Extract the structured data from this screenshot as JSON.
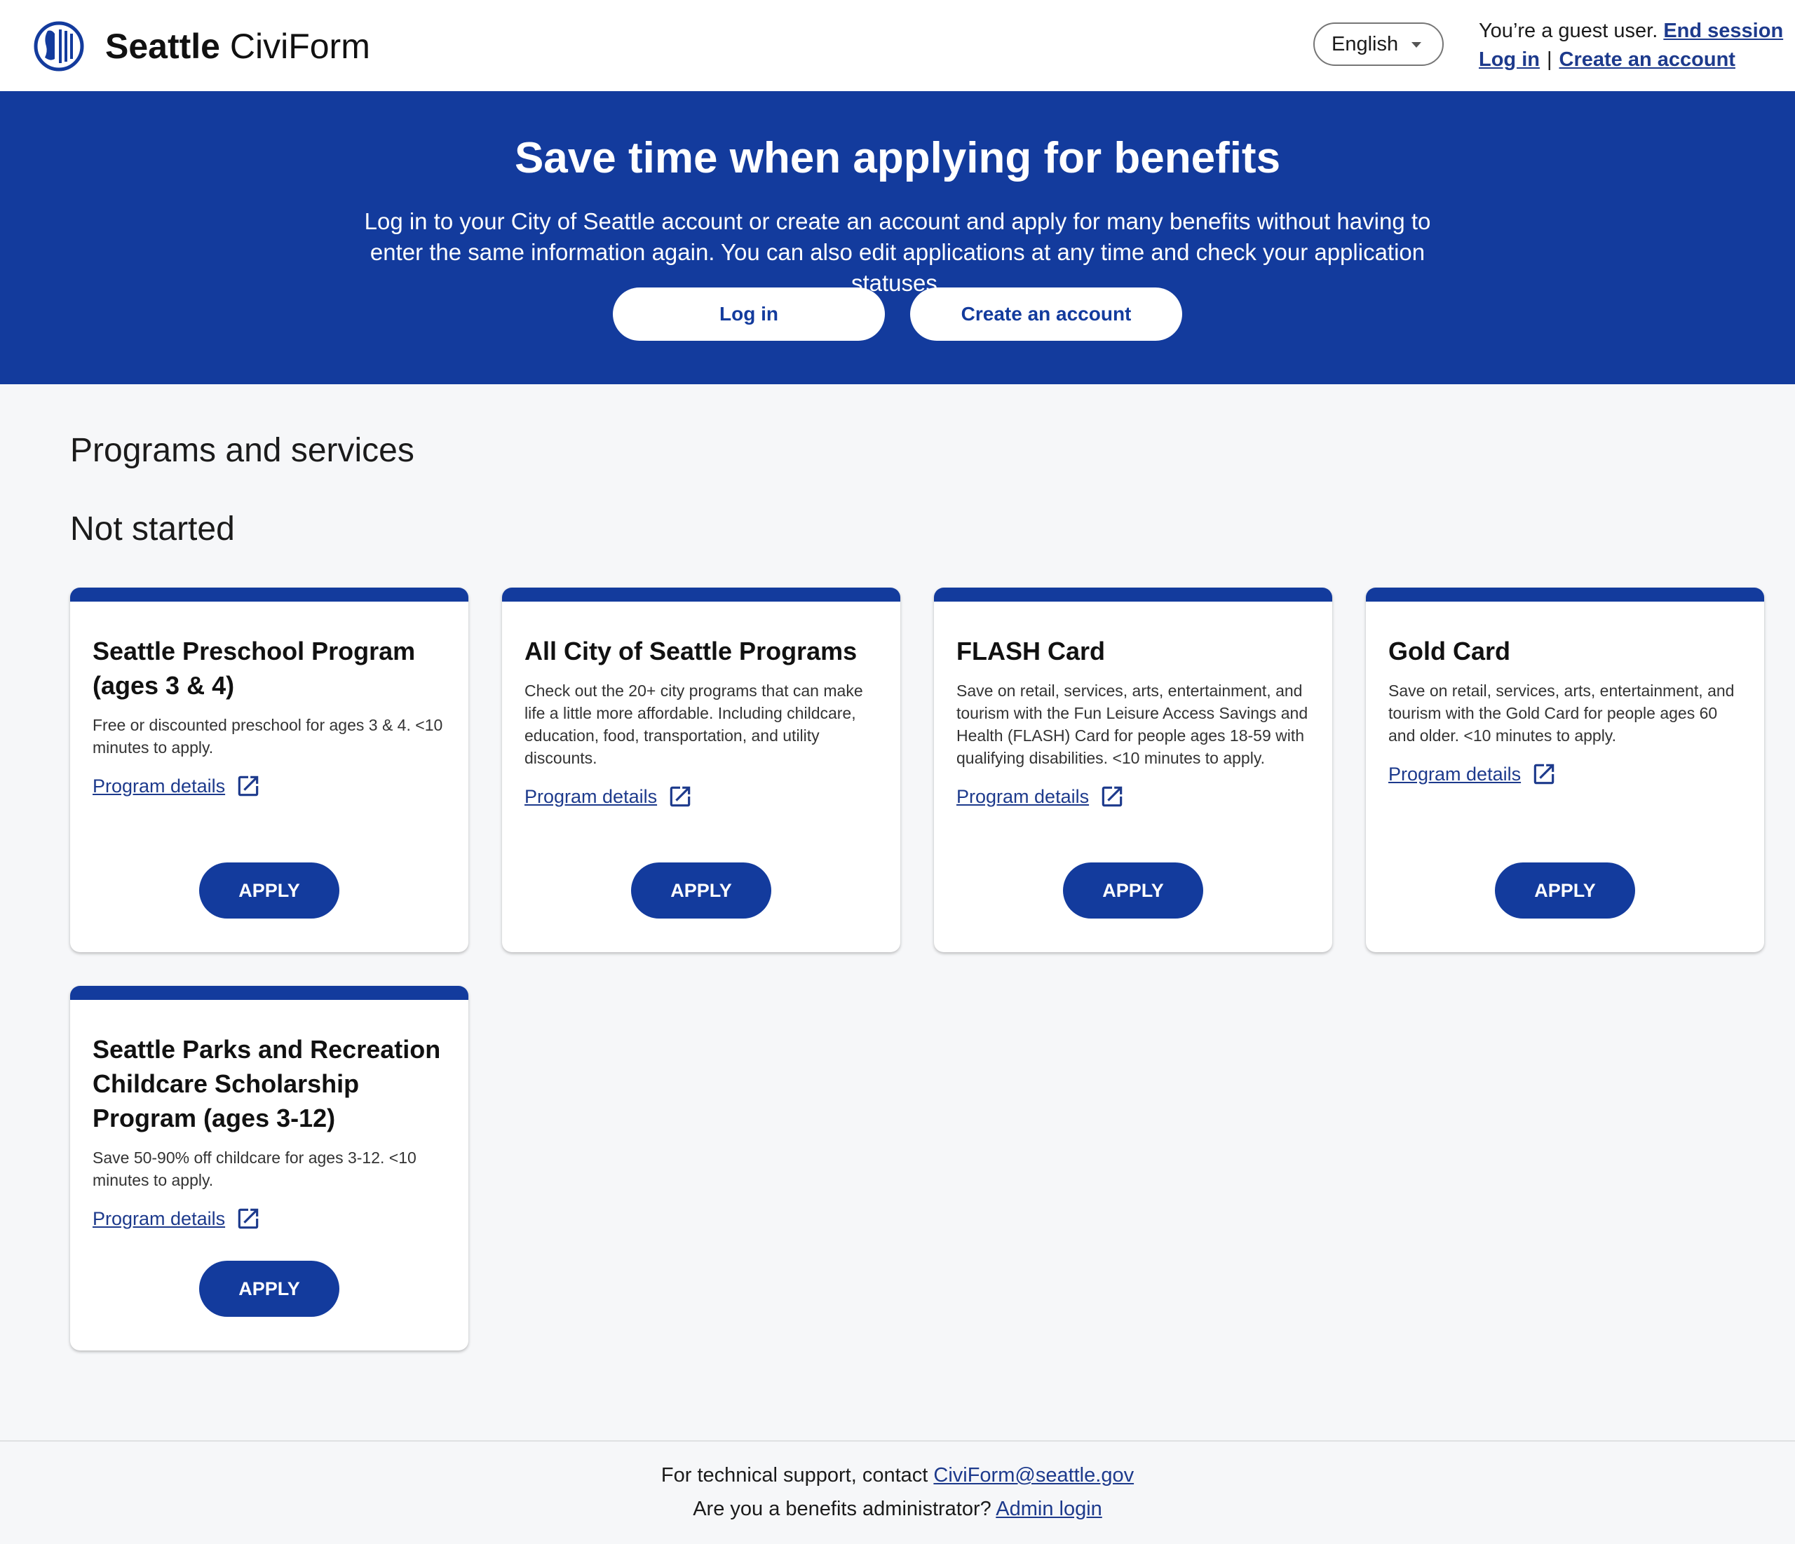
{
  "header": {
    "brand_city": "Seattle",
    "brand_app": "CiviForm",
    "language": "English",
    "guest_text": "You’re a guest user.",
    "end_session": "End session",
    "login": "Log in",
    "separator": "|",
    "create_account": "Create an account"
  },
  "hero": {
    "title": "Save time when applying for benefits",
    "description": "Log in to your City of Seattle account or create an account and apply for many benefits without having to enter the same information again. You can also edit applications at any time and check your application statuses.",
    "login_button": "Log in",
    "create_button": "Create an account"
  },
  "main": {
    "title": "Programs and services",
    "subtitle": "Not started",
    "programs": [
      {
        "title": "Seattle Preschool Program (ages 3 & 4)",
        "description": "Free or discounted preschool for ages 3 & 4. <10 minutes to apply.",
        "details_label": "Program details",
        "apply_label": "APPLY"
      },
      {
        "title": "All City of Seattle Programs",
        "description": "Check out the 20+ city programs that can make life a little more affordable. Including childcare, education, food, transportation, and utility discounts.",
        "details_label": "Program details",
        "apply_label": "APPLY"
      },
      {
        "title": "FLASH Card",
        "description": "Save on retail, services, arts, entertainment, and tourism with the Fun Leisure Access Savings and Health (FLASH) Card for people ages 18-59 with qualifying disabilities. <10 minutes to apply.",
        "details_label": "Program details",
        "apply_label": "APPLY"
      },
      {
        "title": "Gold Card",
        "description": "Save on retail, services, arts, entertainment, and tourism with the Gold Card for people ages 60 and older. <10 minutes to apply.",
        "details_label": "Program details",
        "apply_label": "APPLY"
      },
      {
        "title": "Seattle Parks and Recreation Childcare Scholarship Program (ages 3-12)",
        "description": "Save 50-90% off childcare for ages 3-12. <10 minutes to apply.",
        "details_label": "Program details",
        "apply_label": "APPLY"
      }
    ]
  },
  "footer": {
    "support_text": "For technical support, contact",
    "support_email": "CiviForm@seattle.gov",
    "admin_text": "Are you a benefits administrator?",
    "admin_link": "Admin login"
  },
  "colors": {
    "brand_blue": "#133b9d",
    "link": "#1d3a8c",
    "page_bg": "#f6f7f9"
  },
  "icons": [
    "seattle-seal-icon",
    "chevron-down-icon",
    "external-link-icon"
  ]
}
